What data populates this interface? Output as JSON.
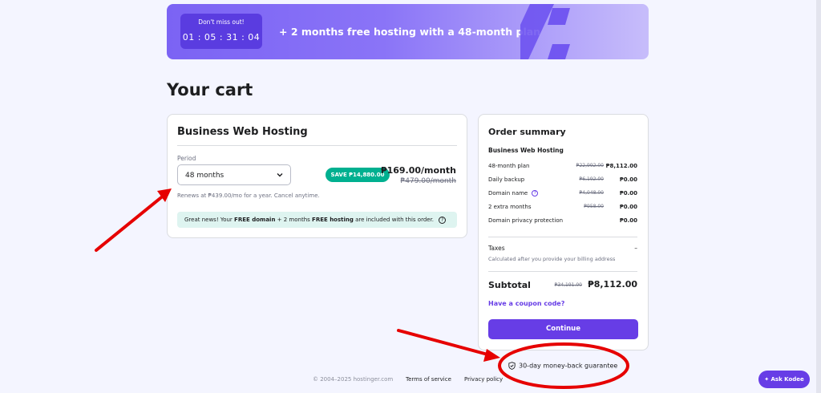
{
  "banner": {
    "timer_label": "Don't miss out!",
    "timer_value": "01 : 05 : 31 : 04",
    "promo_text": "+ 2 months free hosting with a 48-month plan"
  },
  "page_title": "Your cart",
  "product": {
    "title": "Business Web Hosting",
    "period_label": "Period",
    "period_value": "48 months",
    "save_badge": "SAVE ₱14,880.00",
    "price": "₱169.00/month",
    "old_price": "₱479.00/month",
    "renews_note": "Renews at ₱439.00/mo for a year. Cancel anytime.",
    "promo": {
      "part1": "Great news! Your ",
      "bold1": "FREE domain",
      "part2": " + 2 months ",
      "bold2": "FREE hosting",
      "part3": " are included with this order.",
      "help_glyph": "?"
    }
  },
  "summary": {
    "title": "Order summary",
    "product": "Business Web Hosting",
    "rows": [
      {
        "name": "48-month plan",
        "old": "₱22,992.00",
        "new": "₱8,112.00"
      },
      {
        "name": "Daily backup",
        "old": "₱6,192.00",
        "new": "₱0.00"
      },
      {
        "name": "Domain name",
        "old": "₱4,048.00",
        "new": "₱0.00"
      },
      {
        "name": "2 extra months",
        "old": "₱958.00",
        "new": "₱0.00"
      },
      {
        "name": "Domain privacy protection",
        "old": "",
        "new": "₱0.00"
      }
    ],
    "help_glyph": "?",
    "taxes_label": "Taxes",
    "taxes_value": "–",
    "taxes_note": "Calculated after you provide your billing address",
    "subtotal_label": "Subtotal",
    "subtotal_old": "₱34,191.00",
    "subtotal_new": "₱8,112.00",
    "coupon_link": "Have a coupon code?",
    "continue_label": "Continue"
  },
  "guarantee": "30-day money-back guarantee",
  "footer": {
    "copyright": "© 2004–2025 hostinger.com",
    "terms": "Terms of service",
    "privacy": "Privacy policy"
  },
  "ask_kodee": "Ask Kodee",
  "colors": {
    "primary": "#673de6",
    "success": "#00b090",
    "annotation": "#e60000"
  },
  "icons": [
    "chevron-down-icon",
    "help-icon",
    "shield-check-icon",
    "percent-graphic",
    "kodee-icon"
  ]
}
